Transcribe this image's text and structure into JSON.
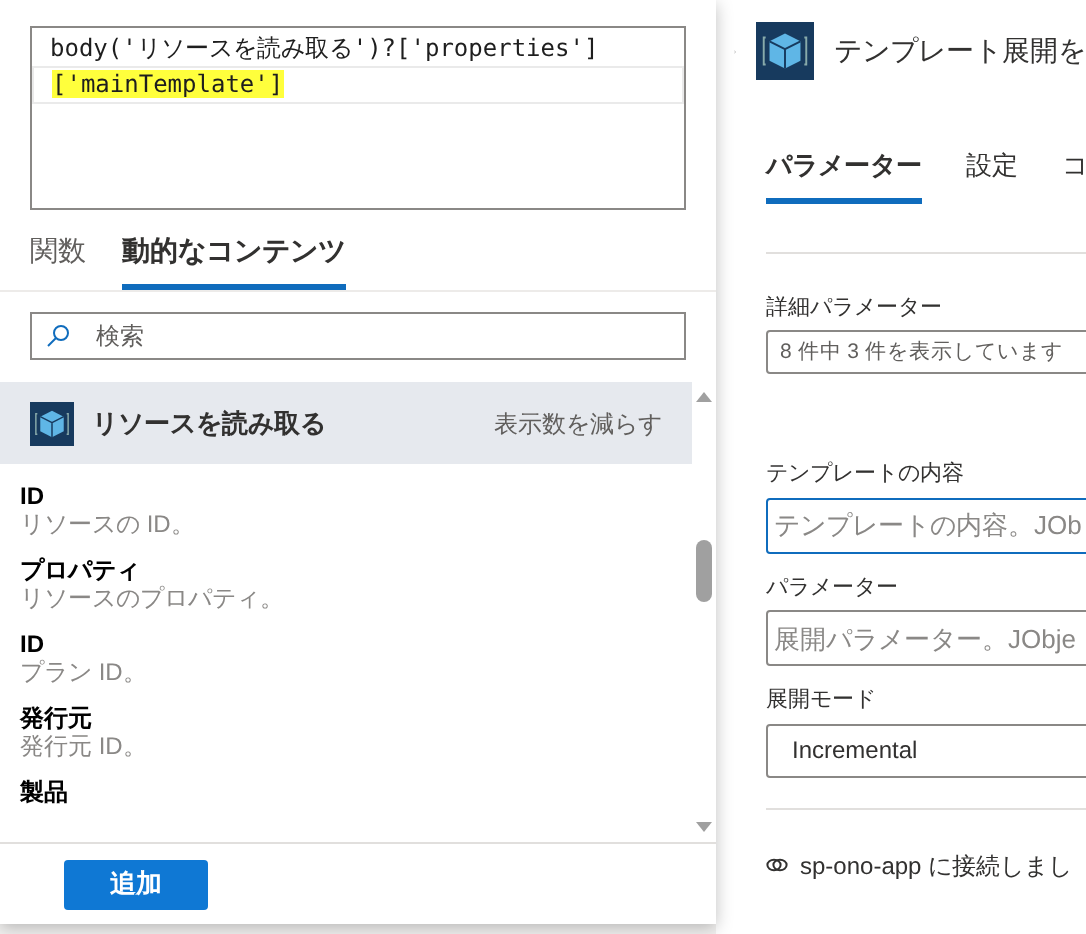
{
  "expression_editor": {
    "lines": [
      {
        "text": "body('リソースを読み取る')?['properties']",
        "highlighted": false
      },
      {
        "text": "['mainTemplate']",
        "highlighted": true
      }
    ]
  },
  "tabs": [
    {
      "label": "関数",
      "selected": false
    },
    {
      "label": "動的なコンテンツ",
      "selected": true
    }
  ],
  "search": {
    "placeholder": "検索"
  },
  "section": {
    "title": "リソースを読み取る",
    "toggle": "表示数を減らす"
  },
  "items": [
    {
      "name": "ID",
      "description": "リソースの ID。"
    },
    {
      "name": "プロパティ",
      "description": "リソースのプロパティ。"
    },
    {
      "name": "ID",
      "description": "プラン ID。"
    },
    {
      "name": "発行元",
      "description": "発行元 ID。"
    },
    {
      "name": "製品"
    }
  ],
  "add_button": "追加",
  "action": {
    "title": "テンプレート展開を",
    "tabs": [
      {
        "label": "パラメーター",
        "selected": true
      },
      {
        "label": "設定",
        "selected": false
      },
      {
        "label": "コ",
        "selected": false
      }
    ],
    "fields": [
      {
        "kind": "dropdown",
        "label": "詳細パラメーター",
        "placeholder": "8 件中 3 件を表示しています",
        "focused": false
      },
      {
        "kind": "text",
        "label": "テンプレートの内容",
        "placeholder": "テンプレートの内容。JOb",
        "focused": true
      },
      {
        "kind": "text",
        "label": "パラメーター",
        "placeholder": "展開パラメーター。JObje",
        "focused": false
      },
      {
        "kind": "select",
        "label": "展開モード",
        "value": "Incremental",
        "focused": false
      }
    ],
    "connection": "sp-ono-app に接続しまし"
  }
}
